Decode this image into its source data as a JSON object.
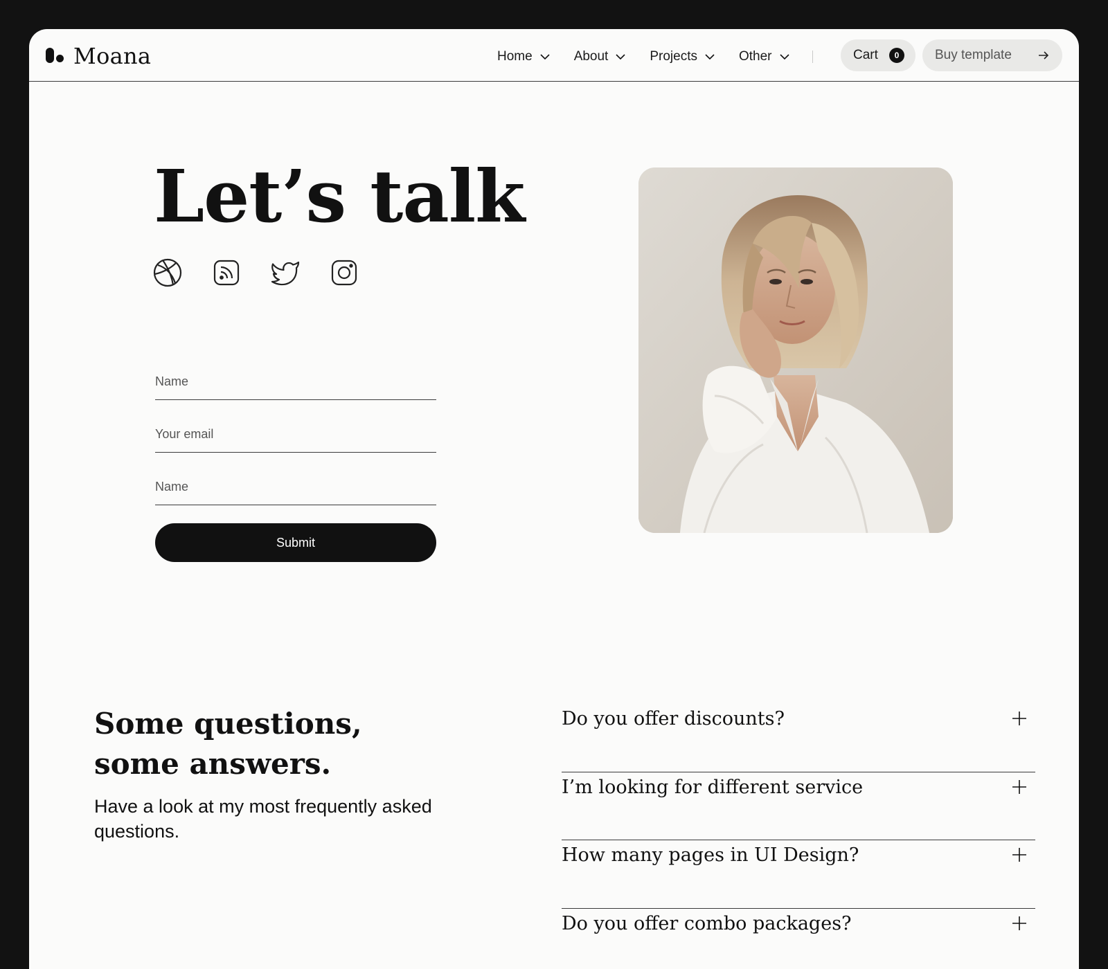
{
  "brand": {
    "name": "Moana"
  },
  "nav": {
    "items": [
      {
        "label": "Home"
      },
      {
        "label": "About"
      },
      {
        "label": "Projects"
      },
      {
        "label": "Other"
      }
    ],
    "cart_label": "Cart",
    "cart_count": "0",
    "buy_label": "Buy template"
  },
  "hero": {
    "title": "Let’s talk",
    "socials": [
      "dribbble-icon",
      "rss-icon",
      "twitter-icon",
      "instagram-icon"
    ]
  },
  "form": {
    "name_placeholder": "Name",
    "email_placeholder": "Your email",
    "message_placeholder": "Name",
    "submit_label": "Submit"
  },
  "faq": {
    "title_line1": "Some questions,",
    "title_line2": "some answers.",
    "subtitle": "Have a look at my most frequently asked questions.",
    "items": [
      {
        "question": "Do you offer discounts?"
      },
      {
        "question": "I’m looking for different service"
      },
      {
        "question": "How many pages in UI Design?"
      },
      {
        "question": "Do you offer combo packages?"
      }
    ]
  },
  "colors": {
    "background": "#121212",
    "page": "#fbfbfa",
    "text": "#111111",
    "pill": "#e9e9e7"
  }
}
